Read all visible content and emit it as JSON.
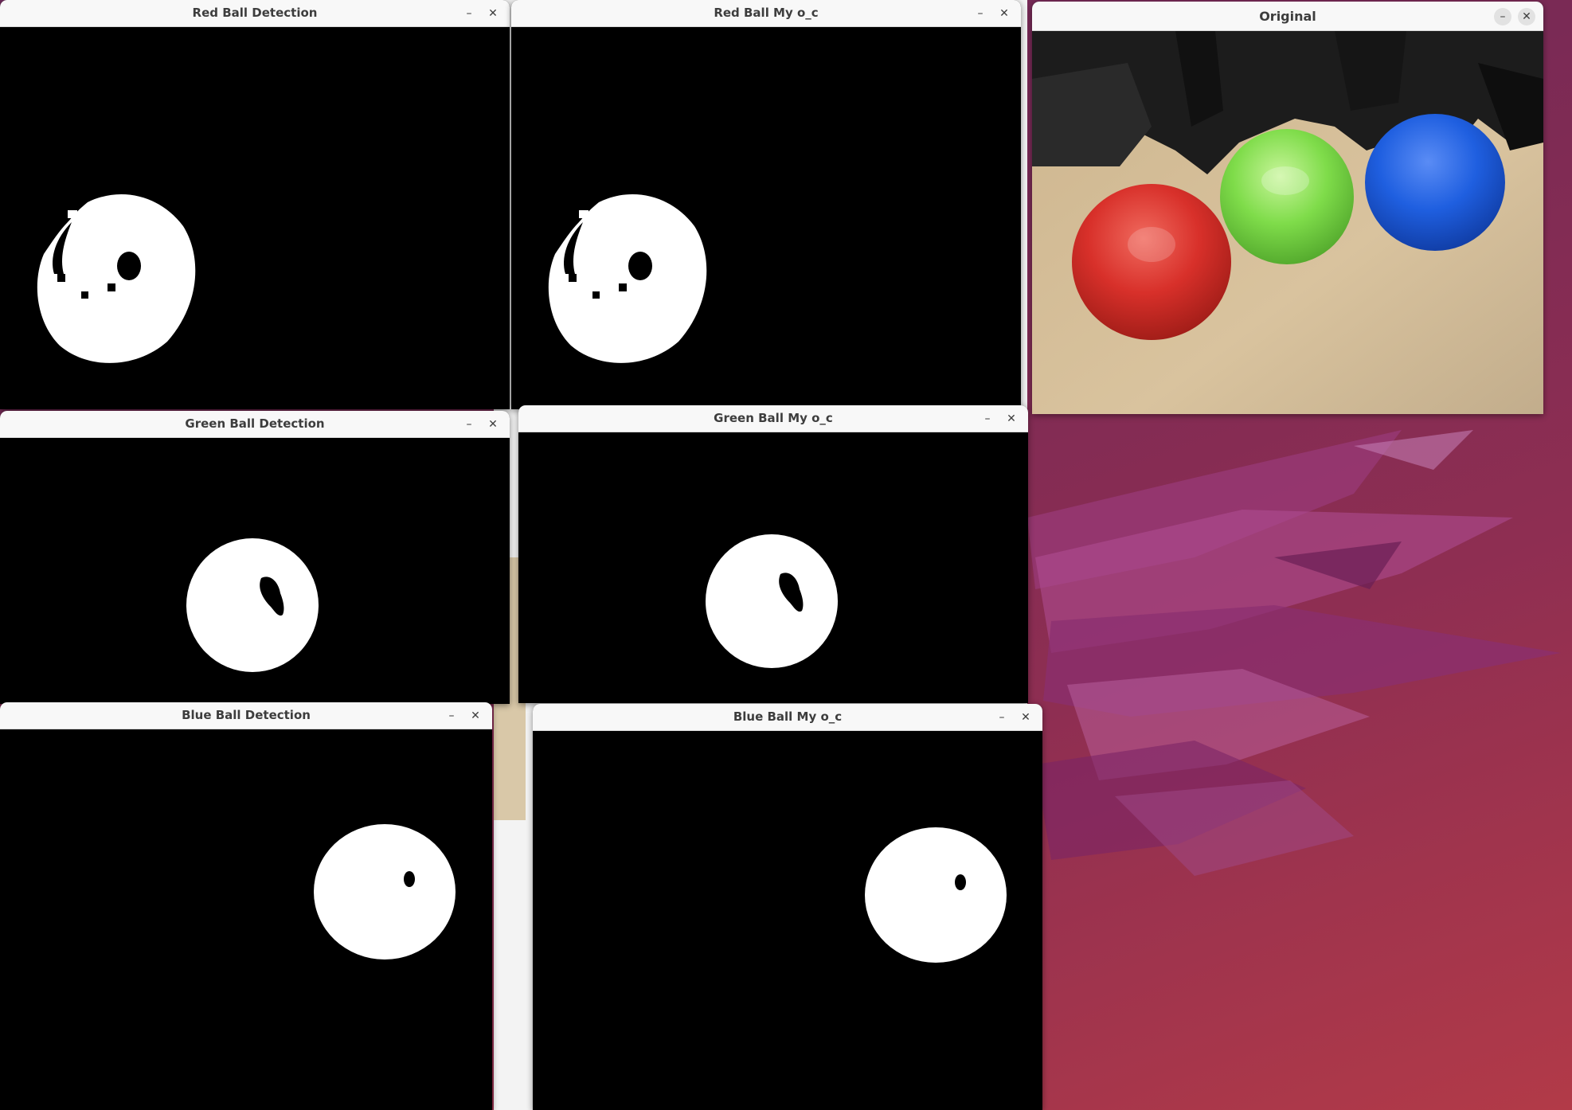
{
  "windows": {
    "red_detection": {
      "title": "Red Ball Detection"
    },
    "red_myoc": {
      "title": "Red Ball My o_c"
    },
    "original": {
      "title": "Original"
    },
    "green_detection": {
      "title": "Green Ball Detection"
    },
    "green_myoc": {
      "title": "Green Ball My o_c"
    },
    "blue_detection": {
      "title": "Blue Ball Detection"
    },
    "blue_myoc": {
      "title": "Blue Ball My o_c"
    }
  },
  "controls": {
    "minimize_glyph": "–",
    "close_glyph": "✕"
  },
  "original_image": {
    "balls": [
      "red",
      "green",
      "blue"
    ],
    "colors": {
      "red": "#d8302a",
      "green": "#7fdc4a",
      "blue": "#1f5fe0"
    }
  },
  "mask_colors": {
    "foreground": "#ffffff",
    "background": "#000000"
  }
}
